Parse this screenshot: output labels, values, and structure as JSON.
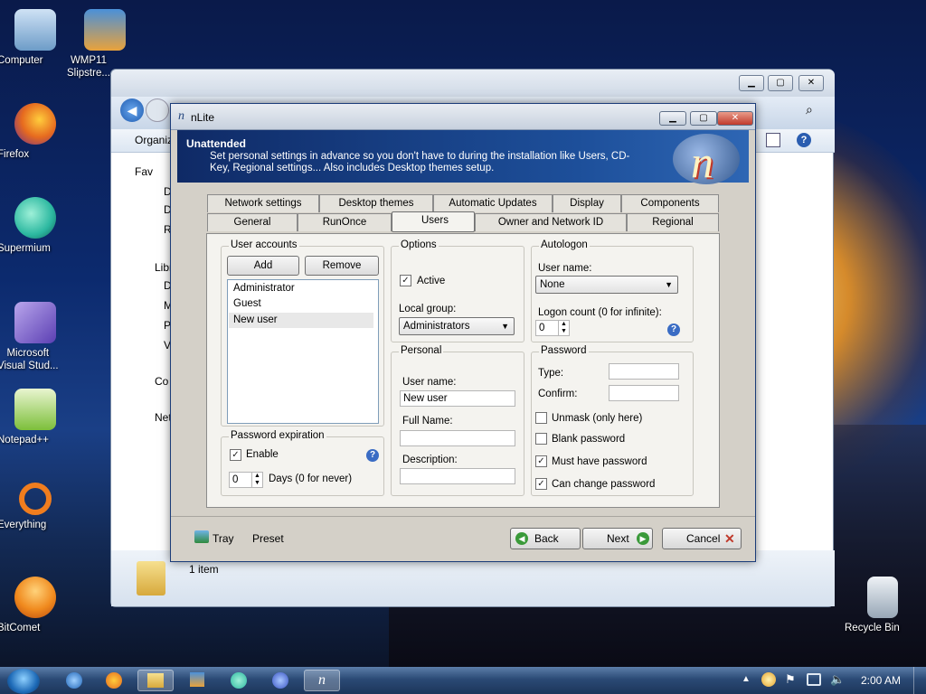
{
  "desktop": {
    "icons": [
      {
        "label": "Computer",
        "icon": "computer-icon",
        "color": "#8fb7e0"
      },
      {
        "label": "WMP11\nSlipstre...",
        "icon": "wmp-icon",
        "color": "#e9a23b"
      },
      {
        "label": "Firefox",
        "icon": "firefox-icon",
        "color": "#e66a1f"
      },
      {
        "label": "Supermium",
        "icon": "supermium-icon",
        "color": "#2cb8a0"
      },
      {
        "label": "Microsoft\nVisual Stud...",
        "icon": "visual-studio-icon",
        "color": "#7a5cc7"
      },
      {
        "label": "Notepad++",
        "icon": "notepadpp-icon",
        "color": "#9bcf52"
      },
      {
        "label": "Everything",
        "icon": "everything-icon",
        "color": "#f07d1e"
      },
      {
        "label": "BitComet",
        "icon": "bitcomet-icon",
        "color": "#f08a1e"
      },
      {
        "label": "Recycle Bin",
        "icon": "recycle-bin-icon",
        "color": "#c9d3de"
      }
    ]
  },
  "explorer": {
    "toolbar_label": "Organiz",
    "sidebar": [
      "Fav",
      "D",
      "D",
      "R",
      "Libr",
      "D",
      "M",
      "P",
      "V",
      "Co",
      "Net"
    ],
    "status": "1 item"
  },
  "dialog": {
    "title": "nLite",
    "banner_heading": "Unattended",
    "banner_desc": "Set personal settings in advance so you don't have to during the installation like Users, CD-Key, Regional settings... Also includes Desktop themes setup.",
    "tabs_back": [
      "Network settings",
      "Desktop themes",
      "Automatic Updates",
      "Display",
      "Components"
    ],
    "tabs_front": [
      "General",
      "RunOnce",
      "Users",
      "Owner and Network ID",
      "Regional"
    ],
    "selected_tab": "Users",
    "user_accounts": {
      "label": "User accounts",
      "add": "Add",
      "remove": "Remove",
      "items": [
        "Administrator",
        "Guest",
        "New user"
      ],
      "selected": "New user"
    },
    "password_expiration": {
      "label": "Password expiration",
      "enable": "Enable",
      "enable_checked": true,
      "days_value": "0",
      "days_label": "Days (0 for never)"
    },
    "options": {
      "label": "Options",
      "active": "Active",
      "active_checked": true,
      "local_group_label": "Local group:",
      "local_group_value": "Administrators"
    },
    "personal": {
      "label": "Personal",
      "username_label": "User name:",
      "username_value": "New user",
      "fullname_label": "Full Name:",
      "fullname_value": "",
      "description_label": "Description:",
      "description_value": ""
    },
    "autologon": {
      "label": "Autologon",
      "username_label": "User name:",
      "username_value": "None",
      "logon_count_label": "Logon count (0 for infinite):",
      "logon_count_value": "0"
    },
    "password": {
      "label": "Password",
      "type_label": "Type:",
      "confirm_label": "Confirm:",
      "checks": [
        {
          "label": "Unmask (only here)",
          "checked": false
        },
        {
          "label": "Blank password",
          "checked": false
        },
        {
          "label": "Must have password",
          "checked": true
        },
        {
          "label": "Can change password",
          "checked": true
        }
      ]
    },
    "footer": {
      "tray": "Tray",
      "preset": "Preset",
      "back": "Back",
      "next": "Next",
      "cancel": "Cancel"
    }
  },
  "taskbar": {
    "clock": "2:00 AM"
  }
}
